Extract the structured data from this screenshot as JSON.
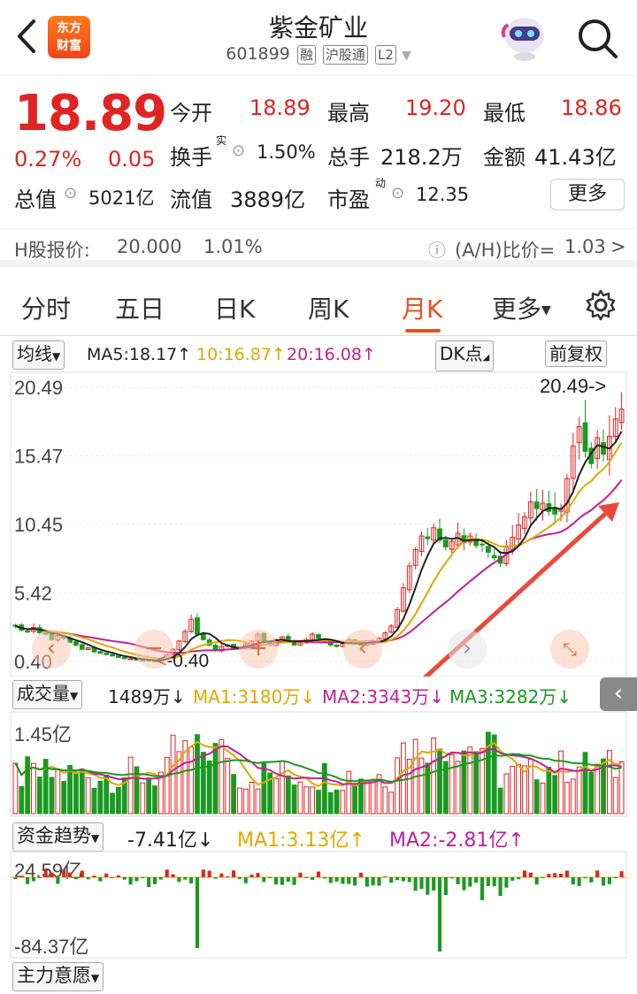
{
  "header": {
    "logo_line1": "东方",
    "logo_line2": "财富",
    "title": "紫金矿业",
    "code": "601899",
    "tag1": "融",
    "tag2": "沪股通",
    "tag3": "L2"
  },
  "quote": {
    "price": "18.89",
    "pct": "0.27%",
    "chg": "0.05",
    "open_label": "今开",
    "open": "18.89",
    "high_label": "最高",
    "high": "19.20",
    "low_label": "最低",
    "low": "18.86",
    "turnover_label": "换手",
    "turnover_sup": "实",
    "turnover": "1.50%",
    "vol_label": "总手",
    "vol": "218.2万",
    "amount_label": "金额",
    "amount": "41.43亿",
    "mcap_label": "总值",
    "mcap": "5021亿",
    "float_label": "流值",
    "float": "3889亿",
    "pe_label": "市盈",
    "pe_sup": "动",
    "pe": "12.35",
    "more_label": "更多"
  },
  "hshare": {
    "label": "H股报价:",
    "price": "20.000",
    "pct": "1.01%",
    "ratio_label": "(A/H)比价=",
    "ratio": "1.03",
    "arrow": ">"
  },
  "tabs": [
    "分时",
    "五日",
    "日K",
    "周K",
    "月K",
    "更多"
  ],
  "active_tab": "月K",
  "ma_row": {
    "selector": "均线",
    "ma5": "MA5:18.17",
    "ma10": "10:16.87",
    "ma20": "20:16.08",
    "dk": "DK点",
    "fq": "前复权"
  },
  "chart_data": {
    "type": "candlestick",
    "y_ticks": [
      "20.49",
      "15.47",
      "10.45",
      "5.42",
      "0.40"
    ],
    "ylim": [
      0.4,
      20.49
    ],
    "max_label": "20.49->",
    "min_label": "<-0.40",
    "close": [
      3.0,
      2.7,
      2.6,
      2.9,
      2.5,
      2.4,
      2.0,
      2.3,
      2.1,
      1.8,
      1.6,
      1.3,
      1.4,
      1.1,
      1.0,
      0.9,
      0.8,
      0.7,
      0.6,
      0.6,
      0.5,
      0.5,
      0.45,
      0.4,
      0.6,
      0.9,
      1.3,
      1.9,
      2.6,
      3.5,
      2.4,
      2.0,
      1.6,
      1.2,
      1.5,
      1.6,
      1.3,
      1.4,
      1.7,
      1.9,
      2.4,
      1.8,
      1.6,
      2.0,
      2.2,
      1.9,
      1.6,
      1.8,
      2.0,
      2.4,
      2.1,
      1.9,
      1.6,
      1.5,
      1.7,
      2.0,
      1.8,
      1.6,
      1.7,
      1.9,
      2.1,
      2.5,
      3.0,
      4.2,
      5.8,
      7.4,
      8.6,
      9.6,
      9.4,
      10.2,
      9.3,
      8.8,
      9.2,
      9.8,
      9.1,
      9.6,
      8.9,
      9.0,
      8.4,
      8.0,
      7.6,
      8.8,
      9.5,
      10.4,
      11.0,
      12.1,
      11.6,
      12.0,
      11.4,
      11.2,
      11.6,
      13.8,
      16.2,
      17.6,
      15.8,
      14.9,
      16.8,
      15.6,
      16.9,
      18.17,
      18.89
    ]
  },
  "vol_row": {
    "label": "成交量",
    "vol": "1489万",
    "ma1": "MA1:3180万",
    "ma2": "MA2:3343万",
    "ma3": "MA3:3282万",
    "arrow_down": "↓",
    "tick": "1.45亿"
  },
  "fund_row": {
    "label": "资金趋势",
    "val": "-7.41亿",
    "ma1": "MA1:3.13亿",
    "ma2": "MA2:-2.81亿",
    "arrow_down": "↓",
    "arrow_up": "↑",
    "top_tick": "24.59亿",
    "bottom_tick": "-84.37亿"
  },
  "intent": {
    "label": "主力意愿"
  },
  "colors": {
    "up": "#e02323",
    "down": "#1a9a20",
    "ma5": "#222222",
    "ma10": "#e0a800",
    "ma20": "#c0209a",
    "accent": "#e8501e"
  }
}
